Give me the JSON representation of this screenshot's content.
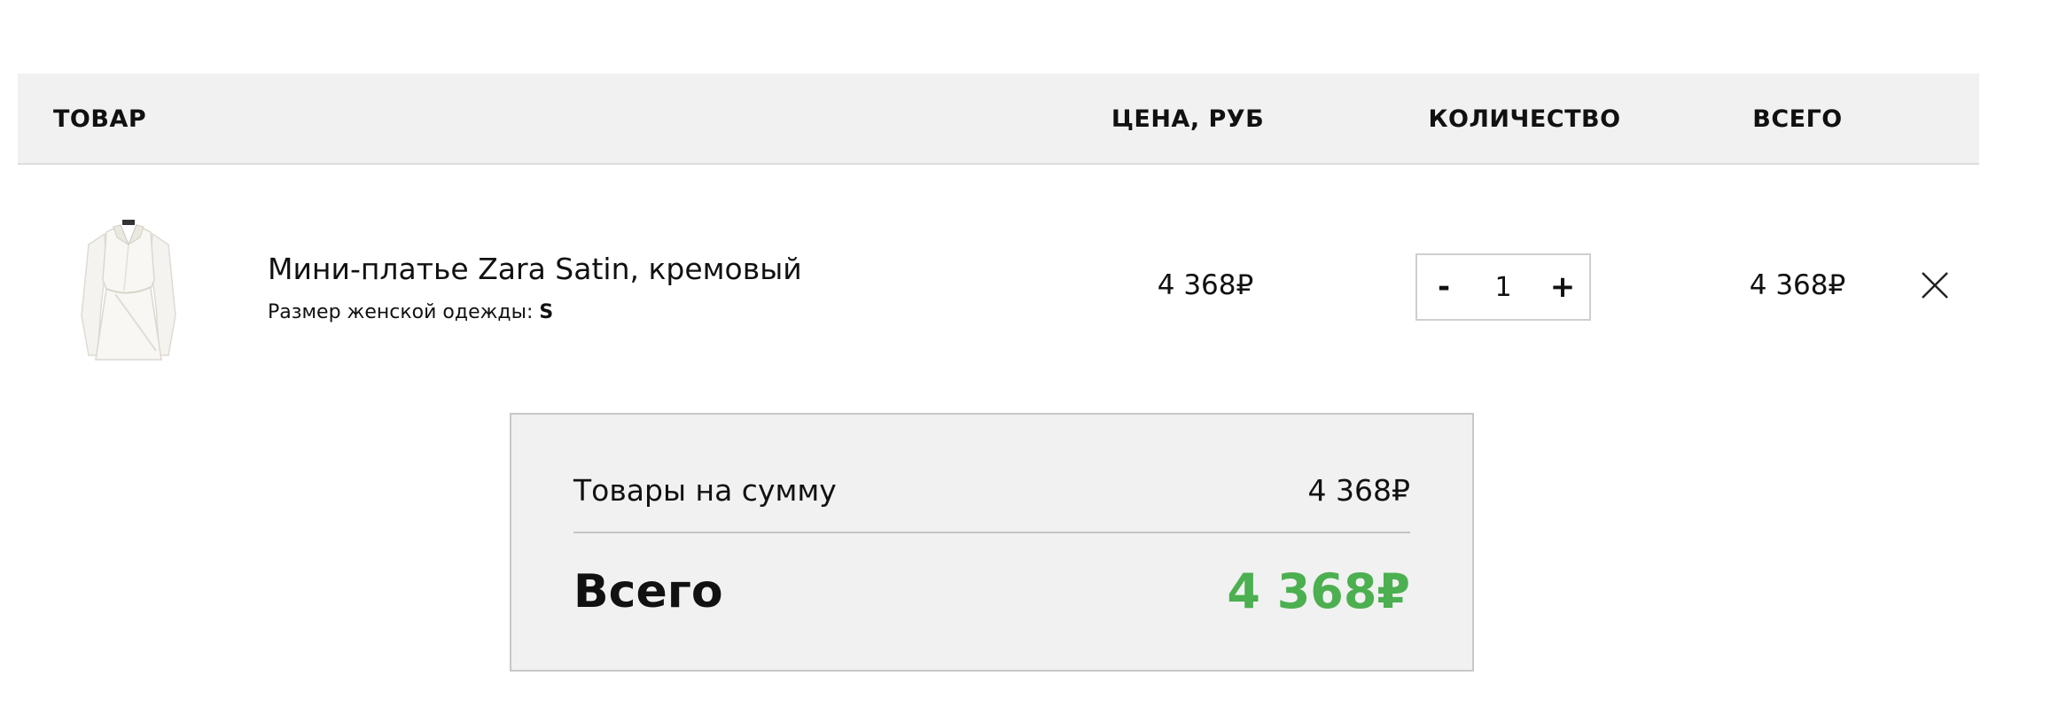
{
  "table_header": {
    "product": "ТОВАР",
    "price": "ЦЕНА, РУБ",
    "quantity": "КОЛИЧЕСТВО",
    "total": "ВСЕГО"
  },
  "items": [
    {
      "image_icon": "dress-thumbnail",
      "name": "Мини-платье Zara Satin, кремовый",
      "attribute_label": "Размер женской одежды: ",
      "attribute_value": "S",
      "price": "4 368₽",
      "qty_minus": "-",
      "qty": "1",
      "qty_plus": "+",
      "total": "4 368₽",
      "remove_icon": "close-icon"
    }
  ],
  "summary": {
    "subtotal_label": "Товары на сумму",
    "subtotal_value": "4 368₽",
    "total_label": "Всего",
    "total_value": "4 368₽",
    "total_color": "#4caf50"
  }
}
